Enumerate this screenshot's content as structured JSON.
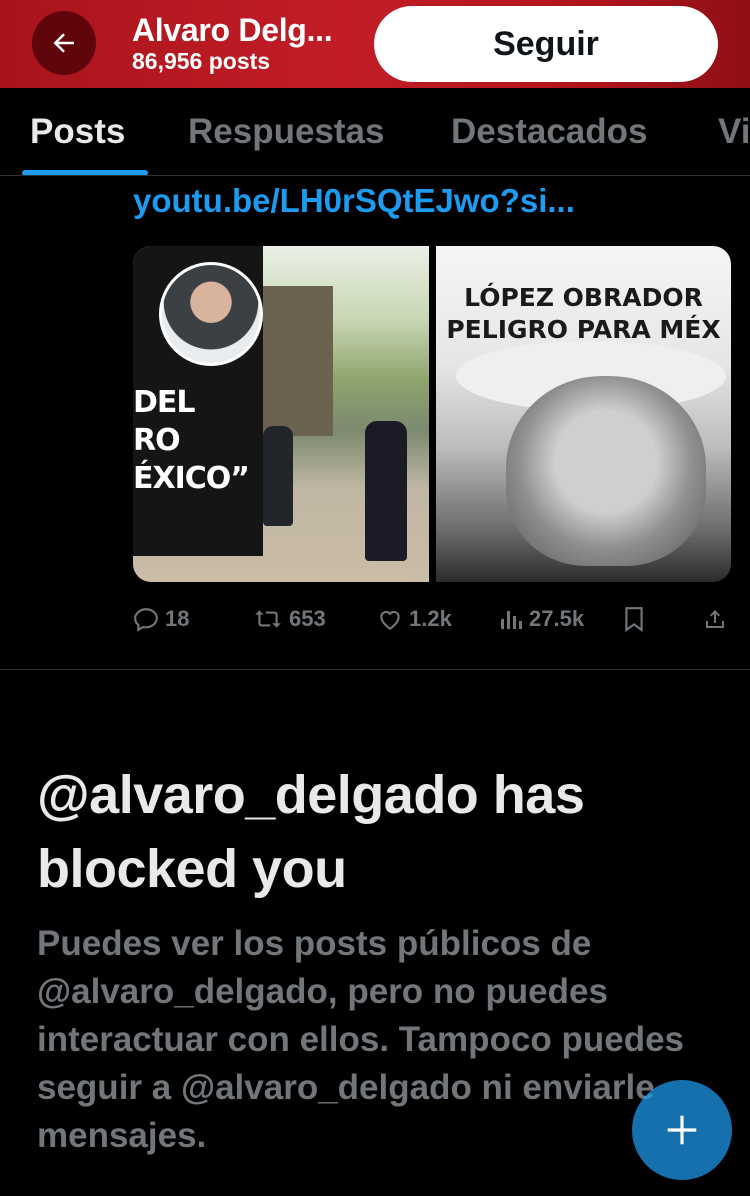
{
  "header": {
    "title": "Alvaro Delg...",
    "posts_count": "86,956 posts",
    "follow_label": "Seguir",
    "background_color": "#b3151e"
  },
  "tabs": [
    {
      "label": "Posts",
      "active": true
    },
    {
      "label": "Respuestas",
      "active": false
    },
    {
      "label": "Destacados",
      "active": false
    },
    {
      "label": "Vi",
      "active": false
    }
  ],
  "post": {
    "link_text": "youtu.be/LH0rSQtEJwo?si...",
    "media": {
      "left_overlay_text": [
        "DEL",
        "RO",
        "ÉXICO”"
      ],
      "right_headline_line1": "LÓPEZ OBRADOR",
      "right_headline_line2": "PELIGRO PARA MÉX"
    },
    "actions": {
      "replies": "18",
      "reposts": "653",
      "likes": "1.2k",
      "views": "27.5k"
    }
  },
  "blocked": {
    "title": "@alvaro_delgado has blocked you",
    "body": "Puedes ver los posts públicos de @alvaro_delgado, pero no puedes interactuar con ellos. Tampoco puedes seguir a @alvaro_delgado ni enviarle mensajes."
  },
  "icons": {
    "back": "arrow-left-icon",
    "reply": "speech-bubble-icon",
    "repost": "repost-icon",
    "like": "heart-icon",
    "views": "bar-chart-icon",
    "bookmark": "bookmark-icon",
    "share": "share-icon",
    "compose": "plus-icon"
  },
  "colors": {
    "accent": "#1d9bf0",
    "muted": "#71767b",
    "text": "#e7e9ea"
  }
}
